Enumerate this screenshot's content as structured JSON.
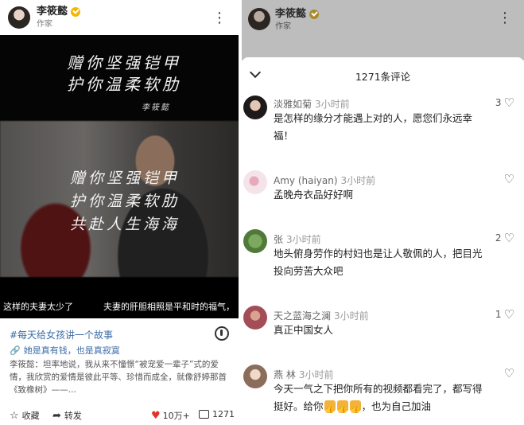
{
  "left": {
    "header": {
      "name": "李筱懿",
      "role": "作家",
      "more": "⋮"
    },
    "video": {
      "top_lines": [
        "赠你坚强铠甲",
        "护你温柔软肋"
      ],
      "top_signature": "李筱懿",
      "photo_lines": [
        "赠你坚强铠甲",
        "护你温柔软肋",
        "共赴人生海海"
      ],
      "caption_left": "这样的夫妻太少了",
      "caption_right": "夫妻的肝胆相照是平和时的福气，"
    },
    "post": {
      "topic": "#每天给女孩讲一个故事",
      "link": "她是真有钱，也是真寂寞",
      "desc": "李筱懿：坦率地说，我从来不憧憬“被宠爱一辈子”式的爱情，我欣赏的爱情是彼此平等、珍惜而成全，就像舒婷那首《致橡树》——…",
      "actions": {
        "favorite": "收藏",
        "repost": "转发",
        "likes": "10万+",
        "comments": "1271"
      }
    }
  },
  "right": {
    "header": {
      "name": "李筱懿",
      "role": "作家",
      "more": "⋮"
    },
    "sheet_title": "1271条评论",
    "comments": [
      {
        "user": "淡雅如菊",
        "time": "3小时前",
        "text": "是怎样的缘分才能遇上对的人，愿您们永远幸福！",
        "likes": "3"
      },
      {
        "user": "Amy (haiyan)",
        "time": "3小时前",
        "text": "孟晚舟衣品好好啊",
        "likes": ""
      },
      {
        "user": "张",
        "time": "3小时前",
        "text": "地头俯身劳作的村妇也是让人敬佩的人，把目光投向劳苦大众吧",
        "likes": "2"
      },
      {
        "user": "天之蓝海之澜",
        "time": "3小时前",
        "text": "真正中国女人",
        "likes": "1"
      },
      {
        "user": "燕 林",
        "time": "3小时前",
        "text_before": "今天一气之下把你所有的视频都看完了，都写得挺好。给你",
        "text_after": "，也为自己加油",
        "likes": ""
      }
    ]
  }
}
